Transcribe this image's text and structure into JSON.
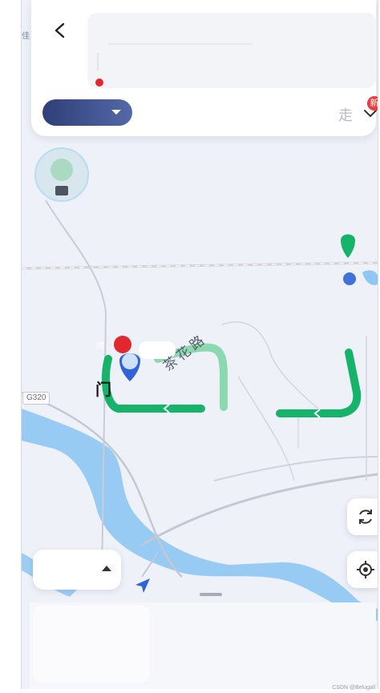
{
  "colors": {
    "map_bg": "#eef1f8",
    "route_green": "#16b36b",
    "route_green_light": "#7fd5a8",
    "water": "#8ec7f2",
    "pill_start": "#2f3f77",
    "pill_end": "#5468a8",
    "start_dot": "#e0282e",
    "badge_red": "#ef3b3b"
  },
  "header": {
    "back_icon": "chevron-left-icon",
    "more_char": "走",
    "new_badge": "新",
    "expand_icon": "chevron-down-icon"
  },
  "map": {
    "side_label": "佳",
    "road_badge": "G320",
    "road_name": "茶花路",
    "poi_char": "门",
    "marker_badge": "终"
  },
  "controls": {
    "refresh_icon": "refresh-icon",
    "locate_icon": "locate-icon",
    "layer_caret_icon": "caret-up-icon"
  },
  "footer": {
    "watermark": "CSDN @Belugall"
  }
}
